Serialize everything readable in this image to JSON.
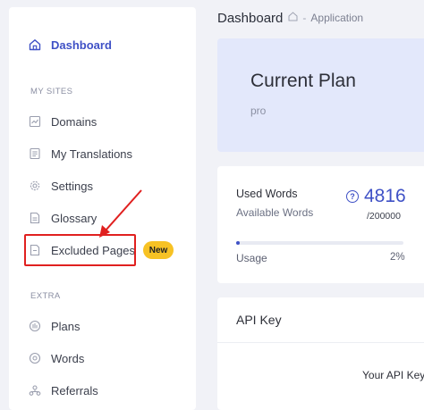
{
  "sidebar": {
    "dashboard": "Dashboard",
    "my_sites_heading": "MY SITES",
    "extra_heading": "EXTRA",
    "items": [
      {
        "label": "Domains",
        "icon": "domains-icon"
      },
      {
        "label": "My Translations",
        "icon": "translations-icon"
      },
      {
        "label": "Settings",
        "icon": "gear-icon"
      },
      {
        "label": "Glossary",
        "icon": "glossary-icon"
      },
      {
        "label": "Excluded Pages",
        "icon": "excluded-pages-icon"
      }
    ],
    "extra_items": [
      {
        "label": "Plans",
        "icon": "plans-icon"
      },
      {
        "label": "Words",
        "icon": "words-icon"
      },
      {
        "label": "Referrals",
        "icon": "referrals-icon"
      }
    ],
    "new_badge": "New"
  },
  "header": {
    "title": "Dashboard",
    "crumb": "Application"
  },
  "plan": {
    "title": "Current Plan",
    "name": "pro"
  },
  "words": {
    "used_label": "Used Words",
    "available_label": "Available Words",
    "count": "4816",
    "total": "/200000",
    "usage_label": "Usage",
    "usage_pct": "2%",
    "usage_fraction": 0.02
  },
  "api": {
    "title": "API Key",
    "subtitle": "Your API Key"
  },
  "colors": {
    "accent": "#3f51c6",
    "highlight": "#e0201f",
    "badge": "#f7c224",
    "plan_bg": "#e3e8fb"
  }
}
